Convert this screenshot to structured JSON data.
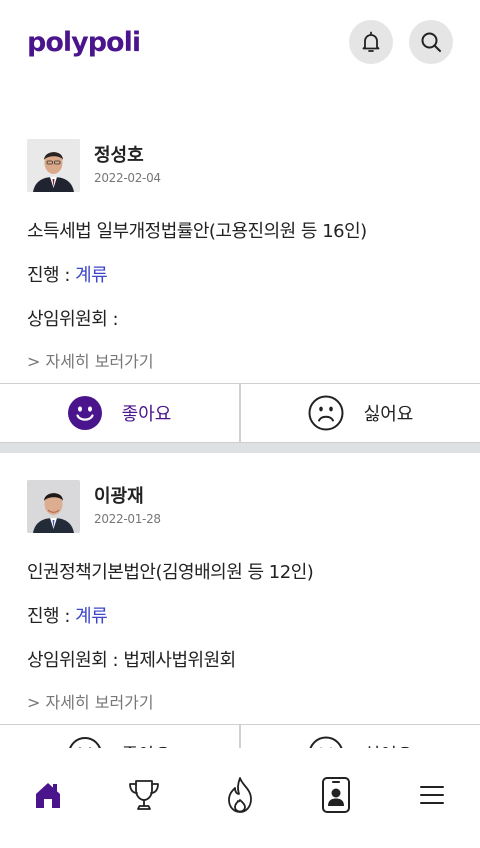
{
  "header": {
    "logo": "polypoli",
    "icons": [
      "bell-icon",
      "search-icon"
    ]
  },
  "posts": [
    {
      "author": "정성호",
      "date": "2022-02-04",
      "bill": "소득세법 일부개정법률안(고용진의원 등 16인)",
      "status_label": "진행 : ",
      "status_value": "계류",
      "committee_label": "상임위원회 : ",
      "committee_value": "",
      "detail_link": "> 자세히 보러가기",
      "like_label": "좋아요",
      "dislike_label": "싫어요"
    },
    {
      "author": "이광재",
      "date": "2022-01-28",
      "bill": "인권정책기본법안(김영배의원 등 12인)",
      "status_label": "진행 : ",
      "status_value": "계류",
      "committee_label": "상임위원회 : ",
      "committee_value": "법제사법위원회",
      "detail_link": "> 자세히 보러가기",
      "like_label": "좋아요",
      "dislike_label": "싫어요"
    }
  ],
  "bottom_nav": [
    "home-icon",
    "trophy-icon",
    "fire-icon",
    "profile-card-icon",
    "menu-icon"
  ],
  "colors": {
    "brand": "#4a148c",
    "status": "#3d46c9",
    "separator": "#dde1e4",
    "icon_bg": "#e5e5e5"
  }
}
